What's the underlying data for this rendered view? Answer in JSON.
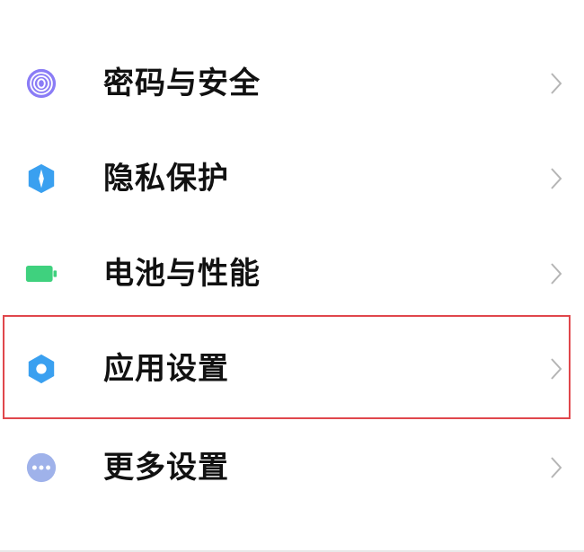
{
  "menu": {
    "items": [
      {
        "label": "密码与安全",
        "icon": "fingerprint-icon",
        "color": "#8a7cf6"
      },
      {
        "label": "隐私保护",
        "icon": "privacy-shield-icon",
        "color": "#3aa0f0"
      },
      {
        "label": "电池与性能",
        "icon": "battery-icon",
        "color": "#3fd17e"
      },
      {
        "label": "应用设置",
        "icon": "gear-icon",
        "color": "#3aa0f0",
        "highlighted": true
      },
      {
        "label": "更多设置",
        "icon": "more-dots-icon",
        "color": "#9fb2ea"
      }
    ]
  },
  "colors": {
    "highlight_border": "#e0474c",
    "label_text": "#111111",
    "chevron": "#b5b5b5"
  }
}
